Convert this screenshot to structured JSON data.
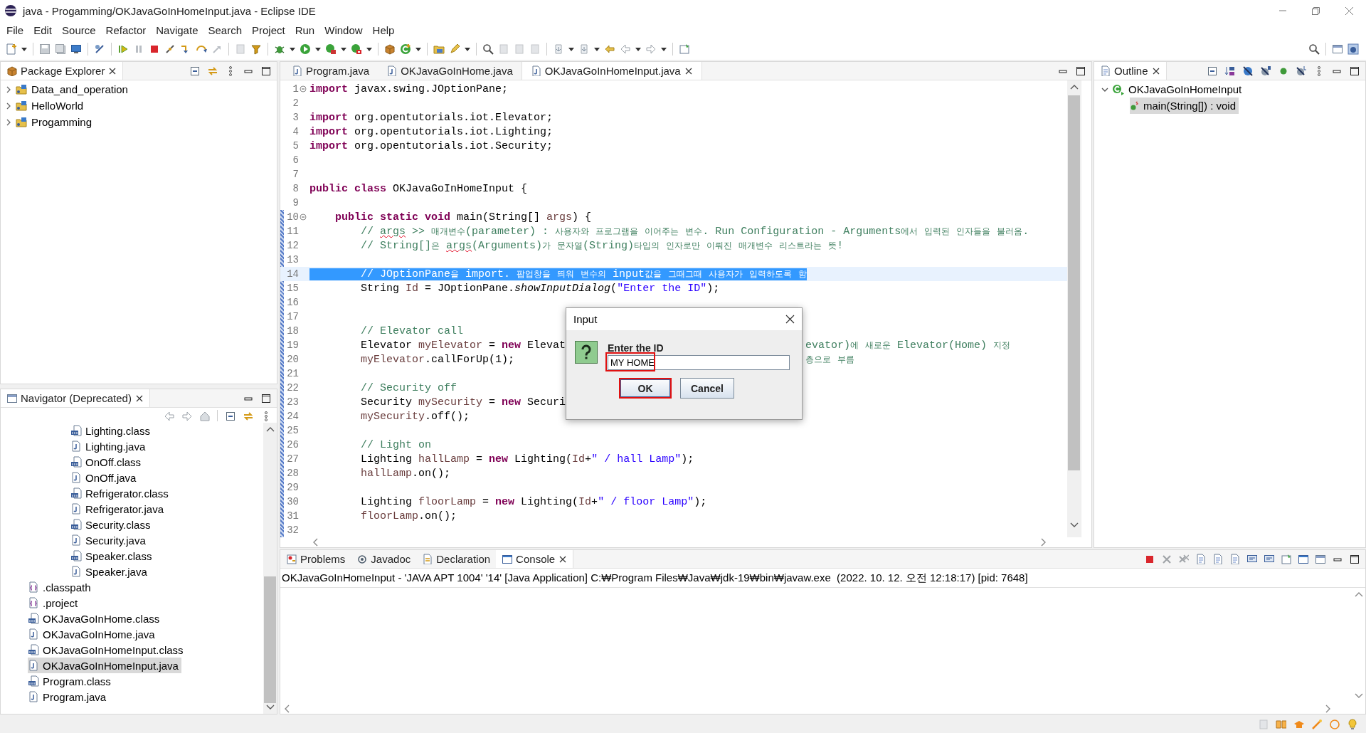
{
  "window": {
    "title": "java - Progamming/OKJavaGoInHomeInput.java - Eclipse IDE"
  },
  "menu": [
    "File",
    "Edit",
    "Source",
    "Refactor",
    "Navigate",
    "Search",
    "Project",
    "Run",
    "Window",
    "Help"
  ],
  "package_explorer": {
    "tab": "Package Explorer",
    "items": [
      {
        "name": "Data_and_operation",
        "expanded": false
      },
      {
        "name": "HelloWorld",
        "expanded": false
      },
      {
        "name": "Progamming",
        "expanded": false
      }
    ]
  },
  "navigator": {
    "tab": "Navigator (Deprecated)",
    "items": [
      {
        "children": [
          {
            "name": "Lighting.class",
            "kind": "class",
            "selected": false
          },
          {
            "name": "Lighting.java",
            "kind": "java",
            "selected": false
          },
          {
            "name": "OnOff.class",
            "kind": "class",
            "selected": false
          },
          {
            "name": "OnOff.java",
            "kind": "java",
            "selected": false
          },
          {
            "name": "Refrigerator.class",
            "kind": "class",
            "selected": false
          },
          {
            "name": "Refrigerator.java",
            "kind": "java",
            "selected": false
          },
          {
            "name": "Security.class",
            "kind": "class",
            "selected": false
          },
          {
            "name": "Security.java",
            "kind": "java",
            "selected": false
          },
          {
            "name": "Speaker.class",
            "kind": "class",
            "selected": false
          },
          {
            "name": "Speaker.java",
            "kind": "java",
            "selected": false
          }
        ]
      },
      {
        "name": ".classpath",
        "kind": "config",
        "selected": false
      },
      {
        "name": ".project",
        "kind": "config",
        "selected": false
      },
      {
        "name": "OKJavaGoInHome.class",
        "kind": "class",
        "selected": false
      },
      {
        "name": "OKJavaGoInHome.java",
        "kind": "java",
        "selected": false
      },
      {
        "name": "OKJavaGoInHomeInput.class",
        "kind": "class",
        "selected": false
      },
      {
        "name": "OKJavaGoInHomeInput.java",
        "kind": "java",
        "selected": true
      },
      {
        "name": "Program.class",
        "kind": "class",
        "selected": false
      },
      {
        "name": "Program.java",
        "kind": "java",
        "selected": false
      }
    ]
  },
  "editor": {
    "tabs": [
      {
        "label": "Program.java",
        "selected": false
      },
      {
        "label": "OKJavaGoInHome.java",
        "selected": false
      },
      {
        "label": "OKJavaGoInHomeInput.java",
        "selected": true
      }
    ],
    "lines": [
      {
        "n": "1",
        "fold": true,
        "selected": false,
        "t": [
          {
            "kind": "keyword",
            "text": "import "
          },
          {
            "kind": "plain",
            "text": "javax.swing.JOptionPane;"
          }
        ]
      },
      {
        "n": "2",
        "fold": false,
        "selected": false
      },
      {
        "n": "3",
        "fold": false,
        "selected": false,
        "t": [
          {
            "kind": "keyword",
            "text": "import "
          },
          {
            "kind": "plain",
            "text": "org.opentutorials.iot.Elevator;"
          }
        ]
      },
      {
        "n": "4",
        "fold": false,
        "selected": false,
        "t": [
          {
            "kind": "keyword",
            "text": "import "
          },
          {
            "kind": "plain",
            "text": "org.opentutorials.iot.Lighting;"
          }
        ]
      },
      {
        "n": "5",
        "fold": false,
        "selected": false,
        "t": [
          {
            "kind": "keyword",
            "text": "import "
          },
          {
            "kind": "plain",
            "text": "org.opentutorials.iot.Security;"
          }
        ]
      },
      {
        "n": "6",
        "fold": false,
        "selected": false
      },
      {
        "n": "7",
        "fold": false,
        "selected": false
      },
      {
        "n": "8",
        "fold": false,
        "selected": false,
        "t": [
          {
            "kind": "keyword",
            "text": "public "
          },
          {
            "kind": "keyword",
            "text": "class "
          },
          {
            "kind": "plain",
            "text": "OKJavaGoInHomeInput {"
          }
        ]
      },
      {
        "n": "9",
        "fold": false,
        "selected": false
      },
      {
        "n": "10",
        "fold": true,
        "selected": false,
        "t": [
          {
            "kind": "keyword",
            "text": "    public "
          },
          {
            "kind": "keyword",
            "text": "static "
          },
          {
            "kind": "keyword",
            "text": "void "
          },
          {
            "kind": "plain",
            "text": "main(String[] "
          },
          {
            "kind": "variable",
            "text": "args"
          },
          {
            "kind": "plain",
            "text": ") {"
          }
        ]
      },
      {
        "n": "11",
        "fold": false,
        "selected": false,
        "t": [
          {
            "kind": "comment",
            "text": "        // "
          },
          {
            "kind": "misspelled",
            "text": "args"
          },
          {
            "kind": "comment",
            "text": " >> 매개변수(parameter) : 사용자와 프로그램을 이어주는 변수. Run Configuration - Arguments에서 입력된 인자들을 불러옴."
          }
        ]
      },
      {
        "n": "12",
        "fold": false,
        "selected": false,
        "t": [
          {
            "kind": "comment",
            "text": "        // String[]은 "
          },
          {
            "kind": "misspelled",
            "text": "args"
          },
          {
            "kind": "comment",
            "text": "(Arguments)가 문자열(String)타입의 인자로만 이뤄진 매개변수 리스트라는 뜻!"
          }
        ]
      },
      {
        "n": "13",
        "fold": false,
        "selected": false
      },
      {
        "n": "14",
        "fold": false,
        "selected": true,
        "t": [
          {
            "kind": "comment",
            "text": "        // JOptionPane을 import. 팝업창을 띄워 변수의 input값을 그때그때 사용자가 입력하도록 함"
          }
        ]
      },
      {
        "n": "15",
        "fold": false,
        "selected": false,
        "t": [
          {
            "kind": "plain",
            "text": "        String "
          },
          {
            "kind": "variable",
            "text": "Id"
          },
          {
            "kind": "plain",
            "text": " = JOptionPane."
          },
          {
            "kind": "static-method",
            "text": "showInputDialog"
          },
          {
            "kind": "plain",
            "text": "("
          },
          {
            "kind": "string",
            "text": "\"Enter the ID\""
          },
          {
            "kind": "plain",
            "text": ");"
          }
        ]
      },
      {
        "n": "16",
        "fold": false,
        "selected": false
      },
      {
        "n": "17",
        "fold": false,
        "selected": false
      },
      {
        "n": "18",
        "fold": false,
        "selected": false,
        "t": [
          {
            "kind": "comment",
            "text": "        // Elevator call"
          }
        ]
      },
      {
        "n": "19",
        "fold": false,
        "selected": false,
        "t": [
          {
            "kind": "plain",
            "text": "        Elevator "
          },
          {
            "kind": "variable",
            "text": "myElevator"
          },
          {
            "kind": "plain",
            "text": " = "
          },
          {
            "kind": "keyword",
            "text": "new "
          },
          {
            "kind": "plain",
            "text": "Elevat"
          }
        ],
        "tail": [
          {
            "kind": "comment",
            "text": "evator)에 새로운 Elevator(Home) 지정"
          }
        ]
      },
      {
        "n": "20",
        "fold": false,
        "selected": false,
        "t": [
          {
            "kind": "variable",
            "text": "        myElevator"
          },
          {
            "kind": "plain",
            "text": ".callForUp(1);"
          }
        ],
        "tail": [
          {
            "kind": "comment",
            "text": "층으로 부름"
          }
        ]
      },
      {
        "n": "21",
        "fold": false,
        "selected": false
      },
      {
        "n": "22",
        "fold": false,
        "selected": false,
        "t": [
          {
            "kind": "comment",
            "text": "        // Security off"
          }
        ]
      },
      {
        "n": "23",
        "fold": false,
        "selected": false,
        "t": [
          {
            "kind": "plain",
            "text": "        Security "
          },
          {
            "kind": "variable",
            "text": "mySecurity"
          },
          {
            "kind": "plain",
            "text": " = "
          },
          {
            "kind": "keyword",
            "text": "new "
          },
          {
            "kind": "plain",
            "text": "Securi"
          }
        ]
      },
      {
        "n": "24",
        "fold": false,
        "selected": false,
        "t": [
          {
            "kind": "variable",
            "text": "        mySecurity"
          },
          {
            "kind": "plain",
            "text": ".off();"
          }
        ]
      },
      {
        "n": "25",
        "fold": false,
        "selected": false
      },
      {
        "n": "26",
        "fold": false,
        "selected": false,
        "t": [
          {
            "kind": "comment",
            "text": "        // Light on"
          }
        ]
      },
      {
        "n": "27",
        "fold": false,
        "selected": false,
        "t": [
          {
            "kind": "plain",
            "text": "        Lighting "
          },
          {
            "kind": "variable",
            "text": "hallLamp"
          },
          {
            "kind": "plain",
            "text": " = "
          },
          {
            "kind": "keyword",
            "text": "new "
          },
          {
            "kind": "plain",
            "text": "Lighting("
          },
          {
            "kind": "variable",
            "text": "Id"
          },
          {
            "kind": "plain",
            "text": "+"
          },
          {
            "kind": "string",
            "text": "\" / hall Lamp\""
          },
          {
            "kind": "plain",
            "text": ");"
          }
        ]
      },
      {
        "n": "28",
        "fold": false,
        "selected": false,
        "t": [
          {
            "kind": "variable",
            "text": "        hallLamp"
          },
          {
            "kind": "plain",
            "text": ".on();"
          }
        ]
      },
      {
        "n": "29",
        "fold": false,
        "selected": false
      },
      {
        "n": "30",
        "fold": false,
        "selected": false,
        "t": [
          {
            "kind": "plain",
            "text": "        Lighting "
          },
          {
            "kind": "variable",
            "text": "floorLamp"
          },
          {
            "kind": "plain",
            "text": " = "
          },
          {
            "kind": "keyword",
            "text": "new "
          },
          {
            "kind": "plain",
            "text": "Lighting("
          },
          {
            "kind": "variable",
            "text": "Id"
          },
          {
            "kind": "plain",
            "text": "+"
          },
          {
            "kind": "string",
            "text": "\" / floor Lamp\""
          },
          {
            "kind": "plain",
            "text": ");"
          }
        ]
      },
      {
        "n": "31",
        "fold": false,
        "selected": false,
        "t": [
          {
            "kind": "variable",
            "text": "        floorLamp"
          },
          {
            "kind": "plain",
            "text": ".on();"
          }
        ]
      },
      {
        "n": "32",
        "fold": false,
        "selected": false
      }
    ]
  },
  "dialog": {
    "title": "Input",
    "prompt": "Enter the ID",
    "value": "MY HOME",
    "field_highlighted": true,
    "buttons": [
      {
        "label": "OK",
        "default": true,
        "highlighted": true
      },
      {
        "label": "Cancel",
        "default": false,
        "highlighted": false
      }
    ]
  },
  "outline": {
    "tab": "Outline",
    "items": [
      {
        "name": "OKJavaGoInHomeInput",
        "kind": "class",
        "expanded": true,
        "selected": false,
        "children": [
          {
            "name": "main(String[]) : void",
            "kind": "method",
            "selected": true
          }
        ]
      }
    ]
  },
  "console": {
    "tabs": [
      {
        "label": "Problems",
        "kind": "problems",
        "selected": false
      },
      {
        "label": "Javadoc",
        "kind": "javadoc",
        "selected": false
      },
      {
        "label": "Declaration",
        "kind": "declaration",
        "selected": false
      },
      {
        "label": "Console",
        "kind": "console",
        "selected": true
      }
    ],
    "launch": "OKJavaGoInHomeInput - 'JAVA APT 1004' '14' [Java Application] C:₩Program Files₩Java₩jdk-19₩bin₩javaw.exe  (2022. 10. 12. 오전 12:18:17) [pid: 7648]"
  }
}
